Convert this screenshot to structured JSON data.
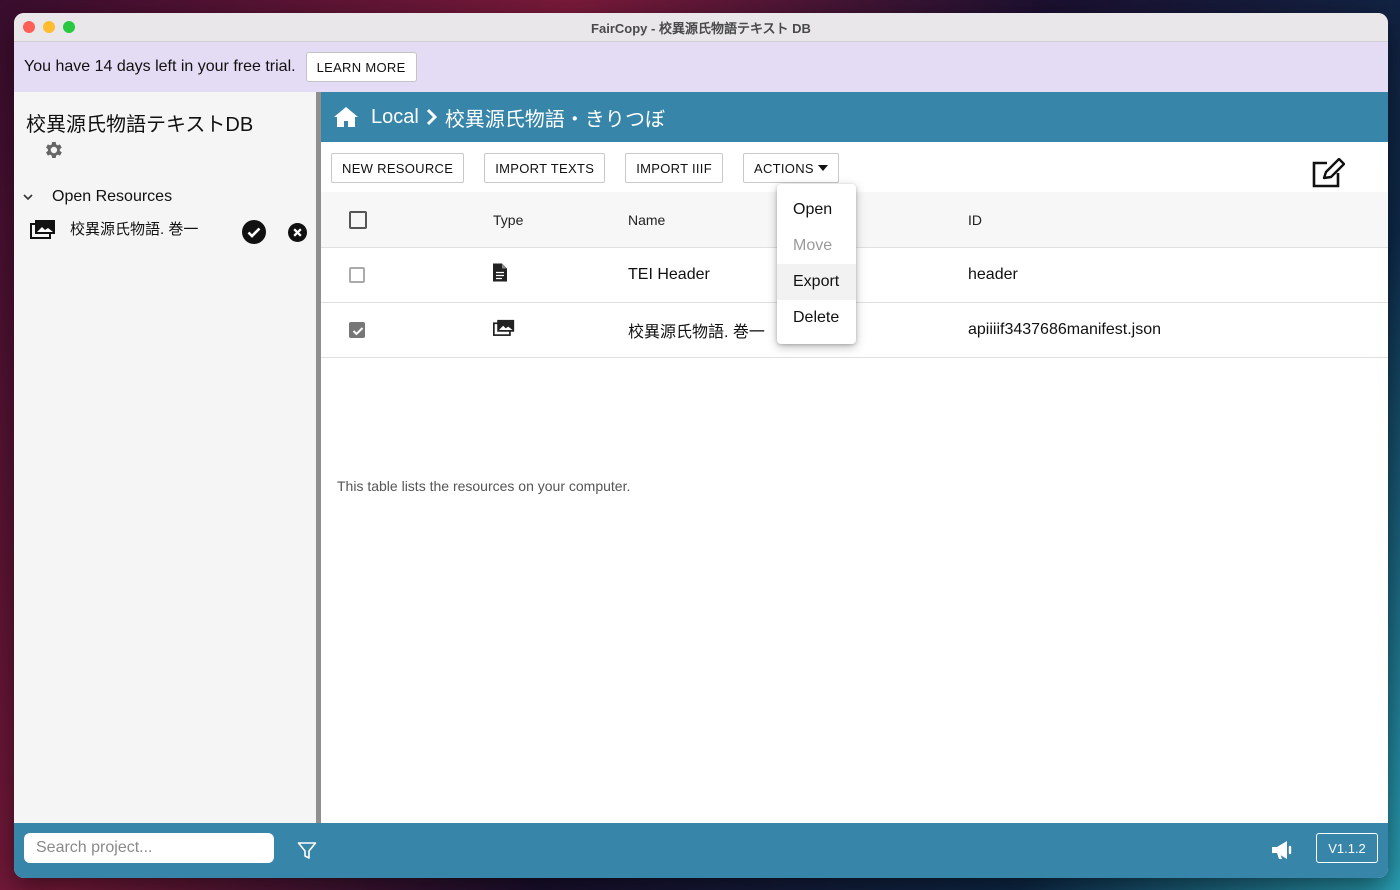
{
  "window": {
    "title": "FairCopy - 校異源氏物語テキスト DB"
  },
  "trial": {
    "message": "You have 14 days left in your free trial.",
    "learn_more": "LEARN MORE"
  },
  "sidebar": {
    "project_title": "校異源氏物語テキストDB",
    "settings_icon": "gear-icon",
    "open_resources_label": "Open Resources",
    "open_resources": [
      {
        "label": "校異源氏物語. 巻一",
        "icon": "image-gallery-icon"
      }
    ]
  },
  "breadcrumb": {
    "home_icon": "home-icon",
    "root": "Local",
    "current": "校異源氏物語・きりつぼ"
  },
  "toolbar": {
    "new_resource": "NEW RESOURCE",
    "import_texts": "IMPORT TEXTS",
    "import_iiif": "IMPORT IIIF",
    "actions": "ACTIONS"
  },
  "table": {
    "headers": {
      "type": "Type",
      "name": "Name",
      "id": "ID"
    },
    "rows": [
      {
        "checked": false,
        "type_icon": "document-icon",
        "name": "TEI Header",
        "id": "header"
      },
      {
        "checked": true,
        "type_icon": "image-gallery-icon",
        "name": "校異源氏物語. 巻一",
        "id": "apiiiif3437686manifest.json"
      }
    ],
    "note": "This table lists the resources on your computer."
  },
  "actions_menu": {
    "items": [
      {
        "label": "Open",
        "enabled": true
      },
      {
        "label": "Move",
        "enabled": false
      },
      {
        "label": "Export",
        "enabled": true,
        "hovered": true
      },
      {
        "label": "Delete",
        "enabled": true
      }
    ]
  },
  "footer": {
    "search_placeholder": "Search project...",
    "search_value": "",
    "version": "V1.1.2"
  },
  "colors": {
    "accent": "#3786aa",
    "trial_bg": "#e4dcf5",
    "sidebar_bg": "#f5f5f5"
  }
}
